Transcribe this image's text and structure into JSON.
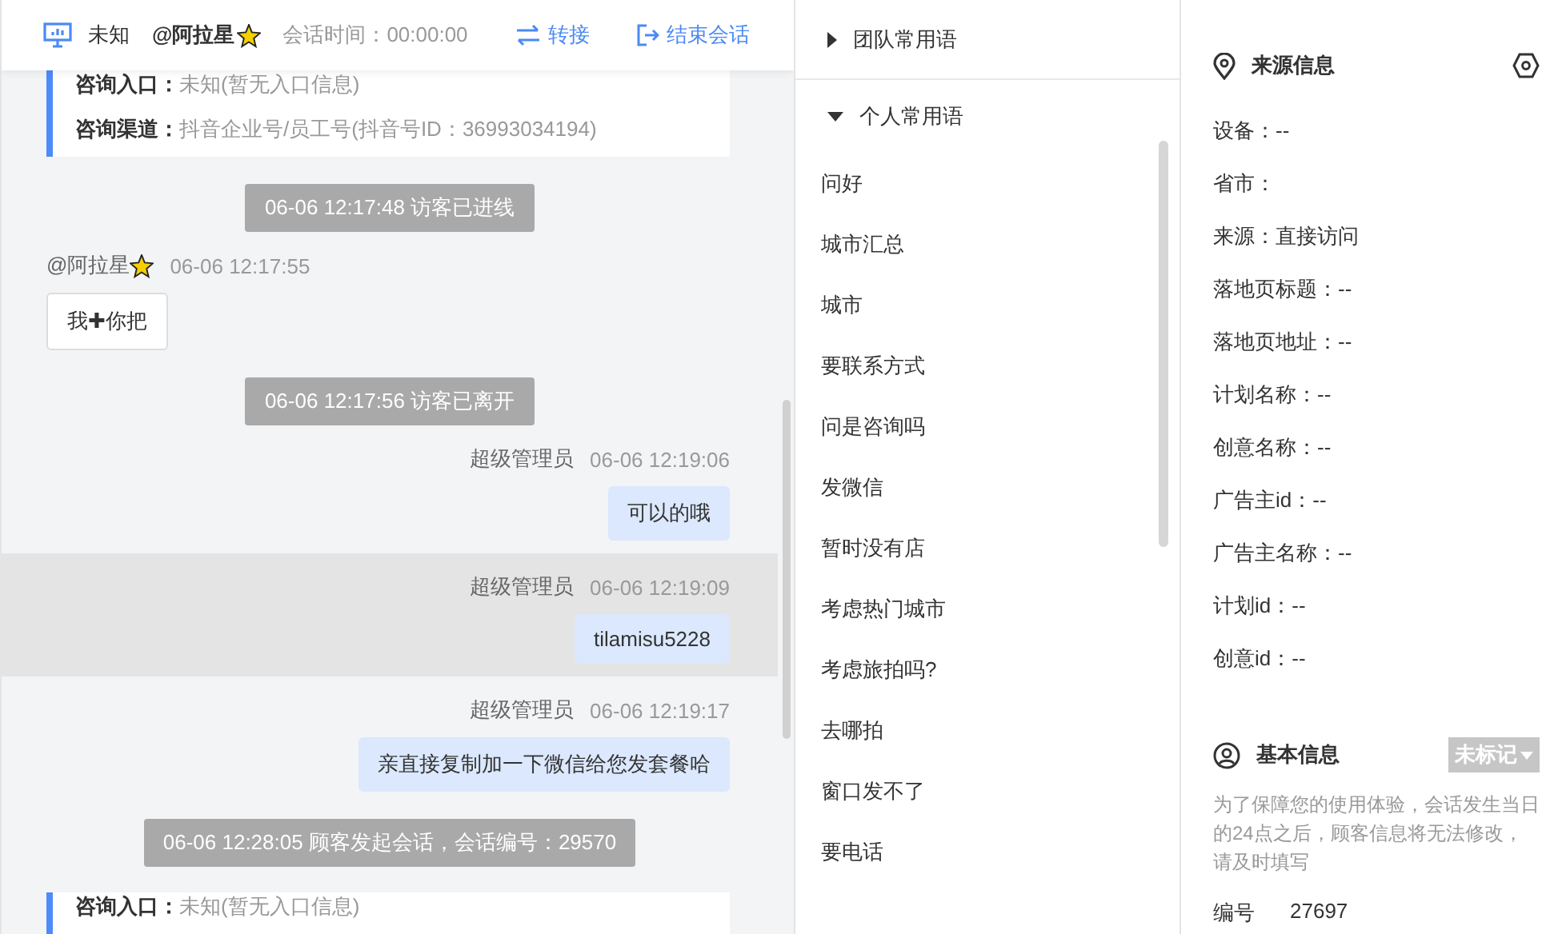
{
  "header": {
    "device": "未知",
    "visitor": "@阿拉星",
    "duration_label": "会话时间：",
    "duration": "00:00:00",
    "actions": [
      {
        "kind": "transfer",
        "label": "转接"
      },
      {
        "kind": "end",
        "label": "结束会话"
      }
    ]
  },
  "chat": [
    {
      "kind": "info",
      "rows": [
        {
          "label": "咨询入口：",
          "value": "未知(暂无入口信息)"
        },
        {
          "label": "咨询渠道：",
          "value": "抖音企业号/员工号(抖音号ID：36993034194)"
        }
      ]
    },
    {
      "kind": "system",
      "text": "06-06 12:17:48 访客已进线"
    },
    {
      "kind": "visitor",
      "name": "@阿拉星",
      "time": "06-06 12:17:55",
      "text": "我✚你把"
    },
    {
      "kind": "system",
      "text": "06-06 12:17:56 访客已离开"
    },
    {
      "kind": "agent",
      "name": "超级管理员",
      "time": "06-06 12:19:06",
      "text": "可以的哦",
      "highlighted": false
    },
    {
      "kind": "agent",
      "name": "超级管理员",
      "time": "06-06 12:19:09",
      "text": "tilamisu5228",
      "highlighted": true
    },
    {
      "kind": "agent",
      "name": "超级管理员",
      "time": "06-06 12:19:17",
      "text": "亲直接复制加一下微信给您发套餐哈",
      "highlighted": false
    },
    {
      "kind": "system",
      "text": "06-06 12:28:05 顾客发起会话，会话编号：29570"
    },
    {
      "kind": "info",
      "rows": [
        {
          "label": "咨询入口：",
          "value": "未知(暂无入口信息)"
        }
      ]
    }
  ],
  "phrases": [
    {
      "title": "团队常用语",
      "expanded": false
    },
    {
      "title": "个人常用语",
      "expanded": true,
      "items": [
        "问好",
        "城市汇总",
        "城市",
        "要联系方式",
        "问是咨询吗",
        "发微信",
        "暂时没有店",
        "考虑热门城市",
        "考虑旅拍吗?",
        "去哪拍",
        "窗口发不了",
        "要电话"
      ]
    }
  ],
  "source_info": {
    "title": "来源信息",
    "fields": [
      "设备：--",
      "省市：",
      "来源：直接访问",
      "落地页标题：--",
      "落地页地址：--",
      "计划名称：--",
      "创意名称：--",
      "广告主id：--",
      "广告主名称：--",
      "计划id：--",
      "创意id：--"
    ]
  },
  "basic_info": {
    "title": "基本信息",
    "tag": "未标记",
    "note": "为了保障您的使用体验，会话发生当日的24点之后，顾客信息将无法修改，请及时填写",
    "fields": [
      {
        "label": "编号",
        "value": "27697"
      }
    ]
  }
}
